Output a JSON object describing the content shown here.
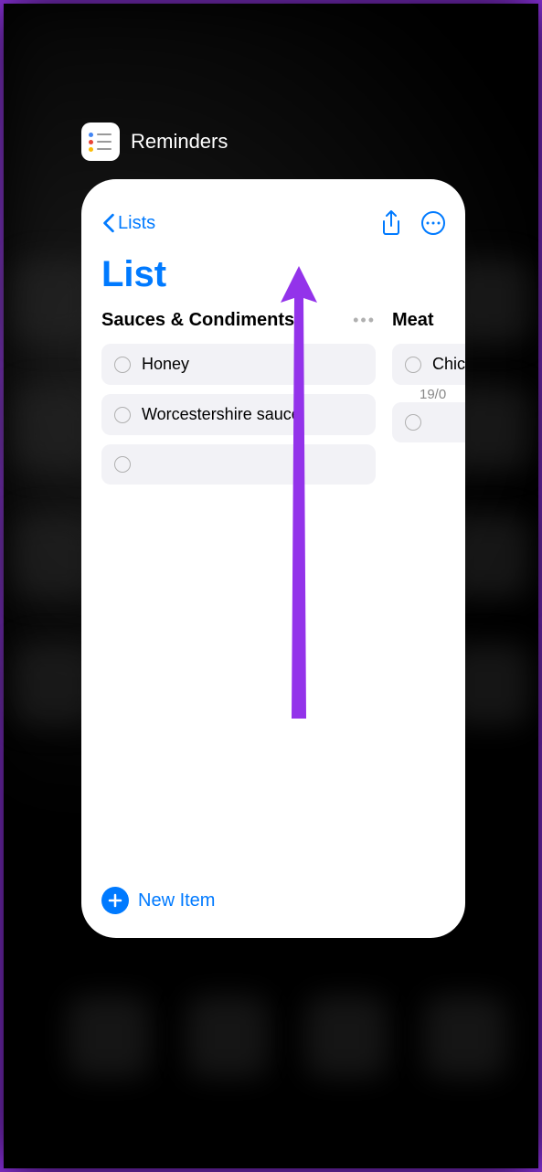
{
  "app": {
    "name": "Reminders"
  },
  "nav": {
    "back_label": "Lists"
  },
  "title": "List",
  "columns": [
    {
      "heading": "Sauces & Condiments",
      "items": [
        "Honey",
        "Worcestershire sauce"
      ]
    },
    {
      "heading": "Meat",
      "items": [
        "Chic"
      ],
      "date": "19/0"
    }
  ],
  "footer": {
    "new_item_label": "New Item"
  },
  "annotation": {
    "arrow_color": "#9333ea"
  }
}
